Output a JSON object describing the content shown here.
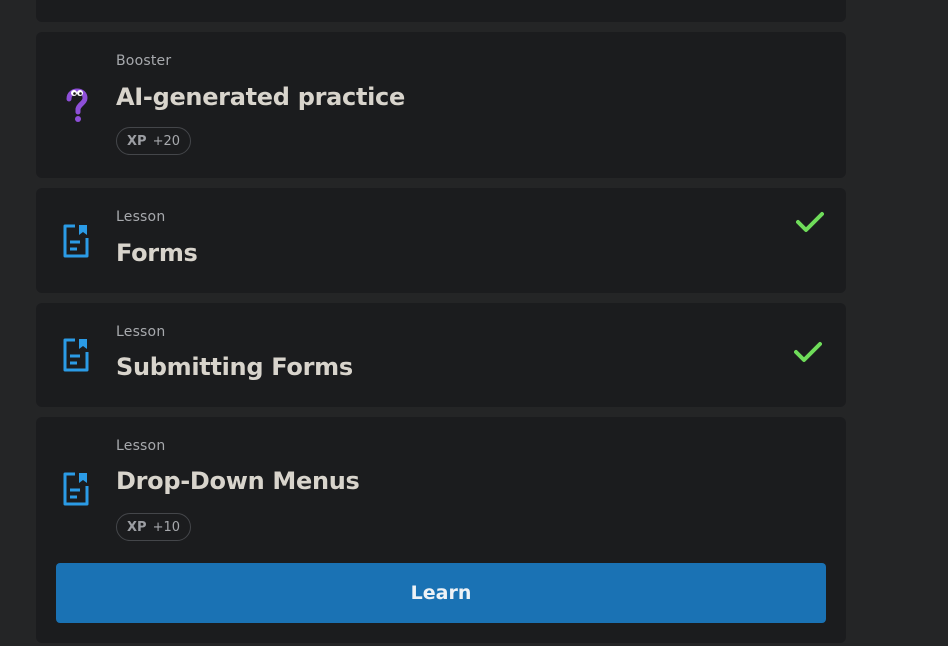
{
  "items": [
    {
      "type_label": "Booster",
      "title": "AI-generated practice",
      "icon": "question-mark-icon",
      "xp_label": "XP",
      "xp_value": "+20",
      "completed": false
    },
    {
      "type_label": "Lesson",
      "title": "Forms",
      "icon": "lesson-document-icon",
      "completed": true
    },
    {
      "type_label": "Lesson",
      "title": "Submitting Forms",
      "icon": "lesson-document-icon",
      "completed": true
    },
    {
      "type_label": "Lesson",
      "title": "Drop-Down Menus",
      "icon": "lesson-document-icon",
      "xp_label": "XP",
      "xp_value": "+10",
      "completed": false,
      "action_label": "Learn"
    }
  ],
  "colors": {
    "background": "#242526",
    "card": "#1b1c1e",
    "accent_blue": "#1a72b4",
    "icon_blue": "#2b9be6",
    "check_green": "#6fdc5a",
    "booster_purple": "#8e4fd8"
  }
}
